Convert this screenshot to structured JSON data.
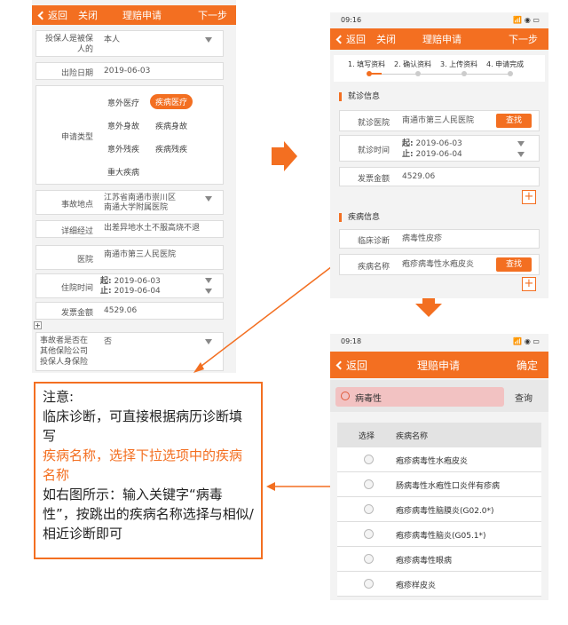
{
  "left": {
    "nav": {
      "back": "返回",
      "close": "关闭",
      "title": "理赔申请",
      "next": "下一步"
    },
    "policyholder": {
      "label": "投保人是被保人的",
      "value": "本人"
    },
    "date": {
      "label": "出险日期",
      "value": "2019-06-03"
    },
    "claim_type": {
      "label": "申请类型",
      "options": [
        "意外医疗",
        "疾病医疗",
        "意外身故",
        "疾病身故",
        "意外残疾",
        "疾病残疾",
        "重大疾病"
      ]
    },
    "location": {
      "label": "事故地点",
      "value1": "江苏省南通市崇川区",
      "value2": "南通大学附属医院"
    },
    "detail": {
      "label": "详细经过",
      "value": "出差异地水土不服高烧不退"
    },
    "hospital": {
      "label": "医院",
      "value": "南通市第三人民医院"
    },
    "stay": {
      "label": "住院时间",
      "start_label": "起:",
      "start": "2019-06-03",
      "end_label": "止:",
      "end": "2019-06-04"
    },
    "invoice": {
      "label": "发票金额",
      "value": "4529.06"
    },
    "plus": "+",
    "other": {
      "label": "事故者是否在其他保险公司投保人身保险",
      "value": "否"
    }
  },
  "note": {
    "title": "注意:",
    "p1": "临床诊断，可直接根据病历诊断填写",
    "p2": "疾病名称，选择下拉选项中的疾病名称",
    "p3": "如右图所示：输入关键字“病毒性”，按跳出的疾病名称选择与相似/相近诊断即可"
  },
  "top_right": {
    "time": "09:16",
    "signal": "📶 ◉ ▭",
    "nav": {
      "back": "返回",
      "close": "关闭",
      "title": "理赔申请",
      "next": "下一步"
    },
    "steps": [
      "1. 填写资料",
      "2. 确认资料",
      "3. 上传资料",
      "4. 申请完成"
    ],
    "visit_section": "就诊信息",
    "visit_hospital": {
      "label": "就诊医院",
      "value": "南通市第三人民医院",
      "btn": "查找"
    },
    "visit_time": {
      "label": "就诊时间",
      "start_label": "起:",
      "start": "2019-06-03",
      "end_label": "止:",
      "end": "2019-06-04"
    },
    "invoice": {
      "label": "发票金额",
      "value": "4529.06"
    },
    "plus": "+",
    "disease_section": "疾病信息",
    "diagnosis": {
      "label": "临床诊断",
      "value": "病毒性皮疹"
    },
    "disease_name": {
      "label": "疾病名称",
      "value": "疱疹病毒性水疱皮炎",
      "btn": "查找"
    },
    "plus2": "+"
  },
  "bottom_right": {
    "time": "09:18",
    "nav": {
      "back": "返回",
      "title": "理赔申请",
      "confirm": "确定"
    },
    "search": {
      "value": "病毒性",
      "btn": "查询"
    },
    "headers": {
      "select": "选择",
      "name": "疾病名称"
    },
    "rows": [
      "疱疹病毒性水疱皮炎",
      "肠病毒性水疱性口炎伴有疹病",
      "疱疹病毒性脑膜炎(G02.0*)",
      "疱疹病毒性脑炎(G05.1*)",
      "疱疹病毒性眼病",
      "疱疹样皮炎"
    ]
  },
  "colors": {
    "accent": "#f36f21"
  }
}
